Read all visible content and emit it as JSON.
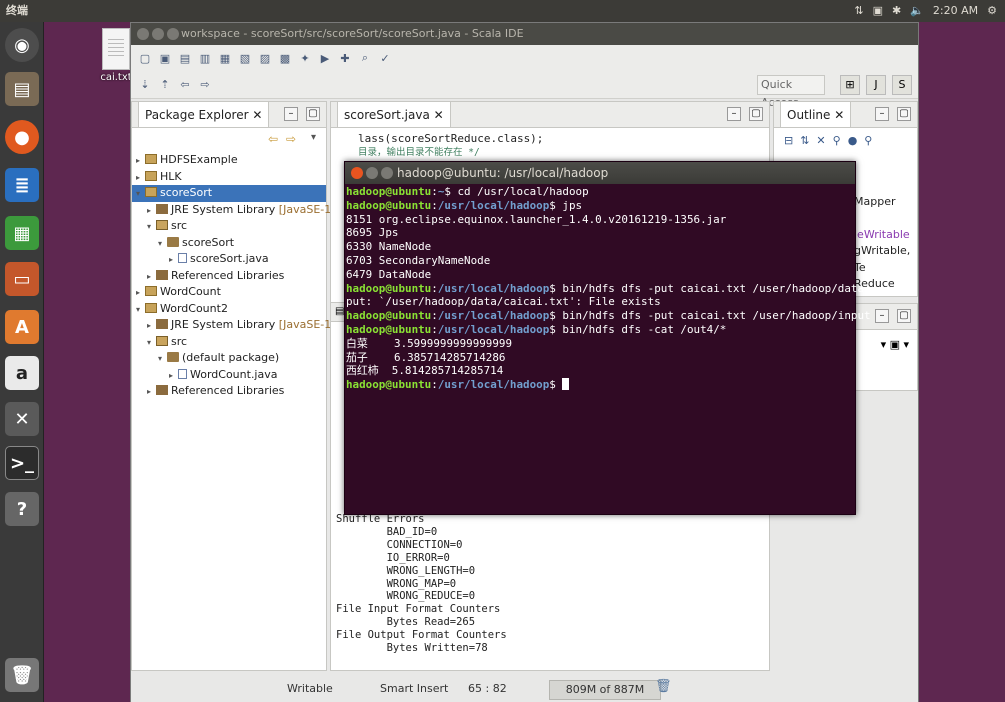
{
  "system_bar": {
    "title": "终端",
    "time": "2:20 AM"
  },
  "desktop": {
    "file_label": "cai.txt"
  },
  "eclipse": {
    "title": "workspace - scoreSort/src/scoreSort/scoreSort.java - Scala IDE",
    "quick_access": "Quick Access",
    "package_explorer": {
      "tab_label": "Package Explorer",
      "tree": [
        {
          "label": "HDFSExample",
          "indent": 0,
          "arrow": "▸",
          "icon": "proj"
        },
        {
          "label": "HLK",
          "indent": 0,
          "arrow": "▸",
          "icon": "proj"
        },
        {
          "label": "scoreSort",
          "indent": 0,
          "arrow": "▾",
          "icon": "proj",
          "selected": true
        },
        {
          "label": "JRE System Library",
          "suffix": "[JavaSE-1.8]",
          "indent": 1,
          "arrow": "▸",
          "icon": "lib"
        },
        {
          "label": "src",
          "indent": 1,
          "arrow": "▾",
          "icon": "src"
        },
        {
          "label": "scoreSort",
          "indent": 2,
          "arrow": "▾",
          "icon": "pkg"
        },
        {
          "label": "scoreSort.java",
          "indent": 3,
          "arrow": "▸",
          "icon": "java"
        },
        {
          "label": "Referenced Libraries",
          "indent": 1,
          "arrow": "▸",
          "icon": "lib"
        },
        {
          "label": "WordCount",
          "indent": 0,
          "arrow": "▸",
          "icon": "proj"
        },
        {
          "label": "WordCount2",
          "indent": 0,
          "arrow": "▾",
          "icon": "proj"
        },
        {
          "label": "JRE System Library",
          "suffix": "[JavaSE-1.8]",
          "indent": 1,
          "arrow": "▸",
          "icon": "lib"
        },
        {
          "label": "src",
          "indent": 1,
          "arrow": "▾",
          "icon": "src"
        },
        {
          "label": "(default package)",
          "indent": 2,
          "arrow": "▾",
          "icon": "pkg"
        },
        {
          "label": "WordCount.java",
          "indent": 3,
          "arrow": "▸",
          "icon": "java"
        },
        {
          "label": "Referenced Libraries",
          "indent": 1,
          "arrow": "▸",
          "icon": "lib"
        }
      ]
    },
    "editor": {
      "tab_label": "scoreSort.java",
      "line1": "lass(scoreSortReduce.class);",
      "line2": "目录，输出目录不能存在 */"
    },
    "outline": {
      "tab_label": "Outline",
      "items": [
        "Mapper",
        "leWritable",
        "gWritable, Te",
        "Reduce"
      ]
    },
    "console_lines": [
      "Shuffle Errors",
      "        BAD_ID=0",
      "        CONNECTION=0",
      "        IO_ERROR=0",
      "        WRONG_LENGTH=0",
      "        WRONG_MAP=0",
      "        WRONG_REDUCE=0",
      "File Input Format Counters",
      "        Bytes Read=265",
      "File Output Format Counters",
      "        Bytes Written=78"
    ],
    "status": {
      "writable": "Writable",
      "insert": "Smart Insert",
      "position": "65 : 82",
      "heap": "809M of 887M"
    }
  },
  "terminal": {
    "title": "hadoop@ubuntu: /usr/local/hadoop",
    "prompt_user": "hadoop@ubuntu",
    "lines": [
      {
        "type": "cmd",
        "path": "~",
        "cmd": "cd /usr/local/hadoop"
      },
      {
        "type": "cmd",
        "path": "/usr/local/hadoop",
        "cmd": "jps"
      },
      {
        "type": "out",
        "text": "8151 org.eclipse.equinox.launcher_1.4.0.v20161219-1356.jar"
      },
      {
        "type": "out",
        "text": "8695 Jps"
      },
      {
        "type": "out",
        "text": "6330 NameNode"
      },
      {
        "type": "out",
        "text": "6703 SecondaryNameNode"
      },
      {
        "type": "out",
        "text": "6479 DataNode"
      },
      {
        "type": "cmd",
        "path": "/usr/local/hadoop",
        "cmd": "bin/hdfs dfs -put caicai.txt /user/hadoop/data"
      },
      {
        "type": "out",
        "text": "put: `/user/hadoop/data/caicai.txt': File exists"
      },
      {
        "type": "cmd",
        "path": "/usr/local/hadoop",
        "cmd": "bin/hdfs dfs -put caicai.txt /user/hadoop/input"
      },
      {
        "type": "cmd",
        "path": "/usr/local/hadoop",
        "cmd": "bin/hdfs dfs -cat /out4/*"
      },
      {
        "type": "out",
        "text": "白菜    3.5999999999999999"
      },
      {
        "type": "out",
        "text": "茄子    6.385714285714286"
      },
      {
        "type": "out",
        "text": "西红柿  5.814285714285714"
      },
      {
        "type": "cursor",
        "path": "/usr/local/hadoop"
      }
    ]
  },
  "launcher_icons": [
    "dash-icon",
    "files-icon",
    "firefox-icon",
    "writer-icon",
    "calc-icon",
    "impress-icon",
    "software-center-icon",
    "amazon-icon",
    "settings-icon",
    "terminal-icon",
    "help-icon",
    "trash-icon"
  ]
}
